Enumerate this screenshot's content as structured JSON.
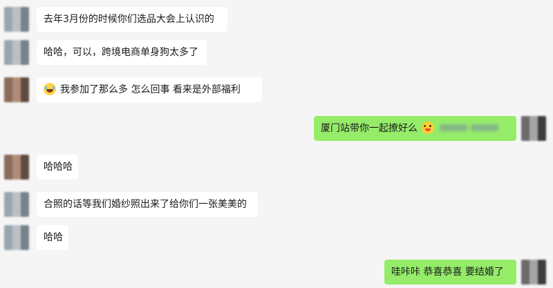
{
  "messages": [
    {
      "side": "left",
      "text": "去年3月份的时候你们选品大会上认识的",
      "avatar_colors": [
        "#9aa6ad",
        "#b9c1c6",
        "#77838b"
      ]
    },
    {
      "side": "left",
      "text": "哈哈，可以，跨境电商单身狗太多了",
      "avatar_colors": [
        "#9aa6ad",
        "#b9c1c6",
        "#77838b"
      ]
    },
    {
      "side": "left",
      "text": "我参加了那么多  怎么回事   看来是外部福利",
      "emoji_before": "laughing-tears-emoji",
      "avatar_colors": [
        "#8a6a5a",
        "#b08c78",
        "#5f4a40"
      ]
    },
    {
      "side": "right",
      "text": "厦门站带你一起撩好么",
      "emoji_after": "wink-emoji",
      "blurred": true,
      "avatar_colors": [
        "#6b6b6b",
        "#a5a5a5",
        "#3d3d3d"
      ]
    },
    {
      "side": "left",
      "text": "哈哈哈",
      "avatar_colors": [
        "#8a6a5a",
        "#b08c78",
        "#5f4a40"
      ]
    },
    {
      "side": "left",
      "text": "合照的话等我们婚纱照出来了给你们一张美美的",
      "avatar_colors": [
        "#9aa6ad",
        "#b9c1c6",
        "#77838b"
      ]
    },
    {
      "side": "left",
      "text": "哈哈",
      "avatar_colors": [
        "#9aa6ad",
        "#b9c1c6",
        "#77838b"
      ]
    },
    {
      "side": "right",
      "text": "哇咔咔  恭喜恭喜  要结婚了",
      "avatar_colors": [
        "#6b6b6b",
        "#a5a5a5",
        "#3d3d3d"
      ]
    }
  ],
  "colors": {
    "background": "#f5f5f5",
    "incoming_bubble": "#ffffff",
    "outgoing_bubble": "#95ec69"
  }
}
